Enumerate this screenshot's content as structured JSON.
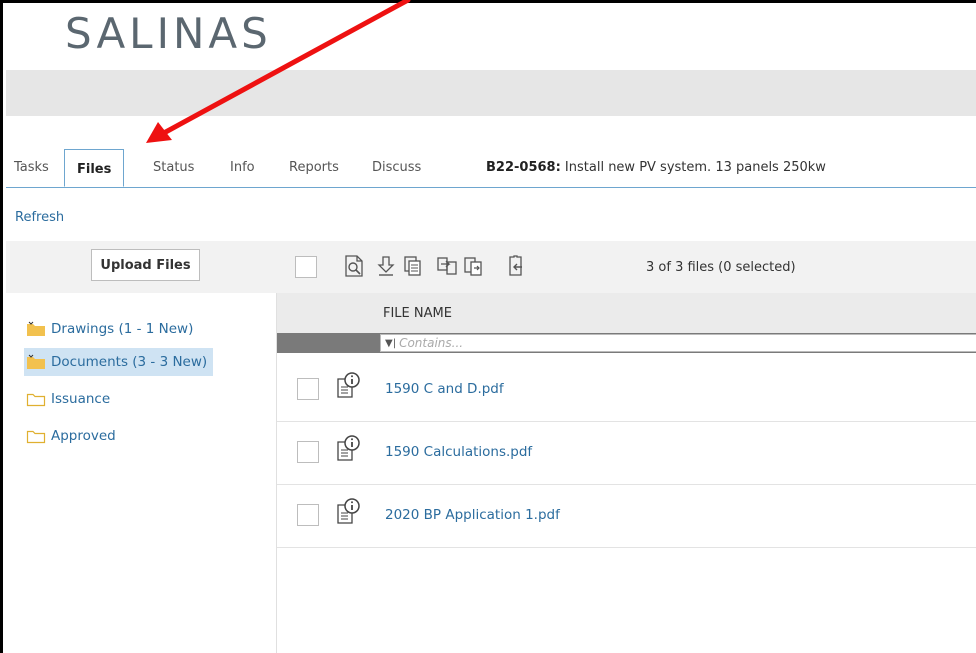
{
  "logo": {
    "text": "SALINAS"
  },
  "tabs": [
    {
      "label": "Tasks"
    },
    {
      "label": "Files",
      "active": true
    },
    {
      "label": "Status"
    },
    {
      "label": "Info"
    },
    {
      "label": "Reports"
    },
    {
      "label": "Discuss"
    }
  ],
  "permit": {
    "number": "B22-0568:",
    "description": "Install new PV system. 13 panels 250kw"
  },
  "refresh_label": "Refresh",
  "toolbar": {
    "upload_label": "Upload Files",
    "count_text": "3 of 3 files (0 selected)",
    "icons": [
      "view-icon",
      "download-icon",
      "copy-icon",
      "move-icon",
      "transfer-icon",
      "export-icon"
    ]
  },
  "folders": [
    {
      "label": "Drawings (1 - 1 New)",
      "icon": "folder-filled-icon"
    },
    {
      "label": "Documents (3 - 3 New)",
      "icon": "folder-filled-icon",
      "selected": true
    },
    {
      "label": "Issuance",
      "icon": "folder-outline-icon"
    },
    {
      "label": "Approved",
      "icon": "folder-outline-icon"
    }
  ],
  "grid": {
    "column_header": "FILE NAME",
    "filter_placeholder": "Contains...",
    "files": [
      {
        "name": "1590 C and D.pdf"
      },
      {
        "name": "1590 Calculations.pdf"
      },
      {
        "name": "2020 BP Application 1.pdf"
      }
    ]
  },
  "colors": {
    "accent": "#2b6c9e",
    "annotation_arrow": "#ee1111",
    "selected_bg": "#cfe3f3"
  }
}
